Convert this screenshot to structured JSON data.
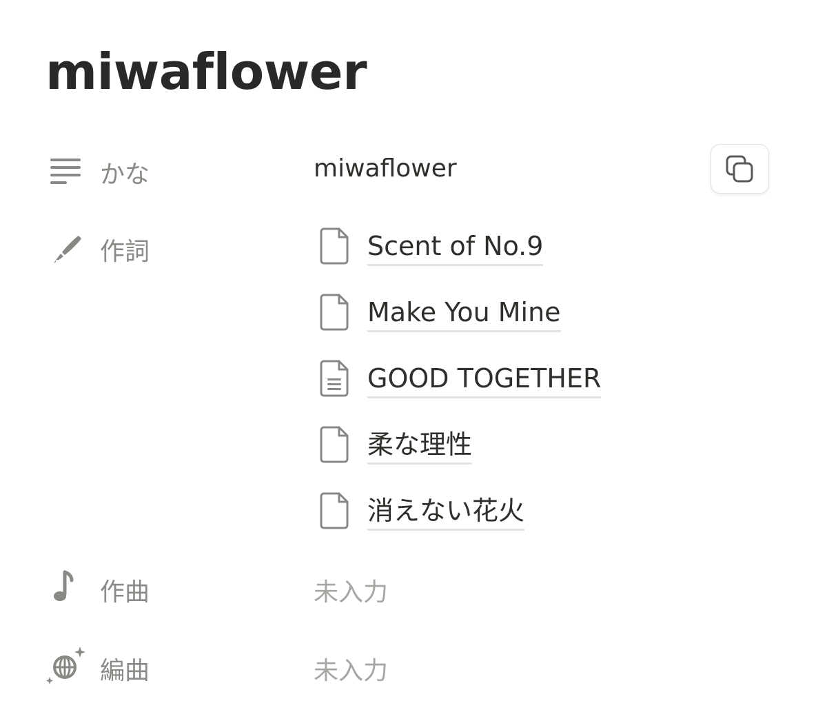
{
  "page": {
    "title": "miwaflower"
  },
  "properties": {
    "kana": {
      "icon": "text-lines-icon",
      "label": "かな",
      "value": "miwaflower"
    },
    "lyrics": {
      "icon": "pen-brush-icon",
      "label": "作詞",
      "items": [
        {
          "title": "Scent of No.9",
          "icon": "blank-page-icon"
        },
        {
          "title": "Make You Mine",
          "icon": "blank-page-icon"
        },
        {
          "title": "GOOD TOGETHER",
          "icon": "text-page-icon"
        },
        {
          "title": "柔な理性",
          "icon": "blank-page-icon"
        },
        {
          "title": "消えない花火",
          "icon": "blank-page-icon"
        }
      ]
    },
    "composition": {
      "icon": "music-note-icon",
      "label": "作曲",
      "value": "未入力"
    },
    "arrangement": {
      "icon": "disco-ball-icon",
      "label": "編曲",
      "value": "未入力"
    }
  },
  "colors": {
    "text": "#2f2e2b",
    "label": "#8c8a86",
    "icon": "#8a8884",
    "placeholder": "#a8a6a2",
    "underline": "#e4e3e0"
  }
}
